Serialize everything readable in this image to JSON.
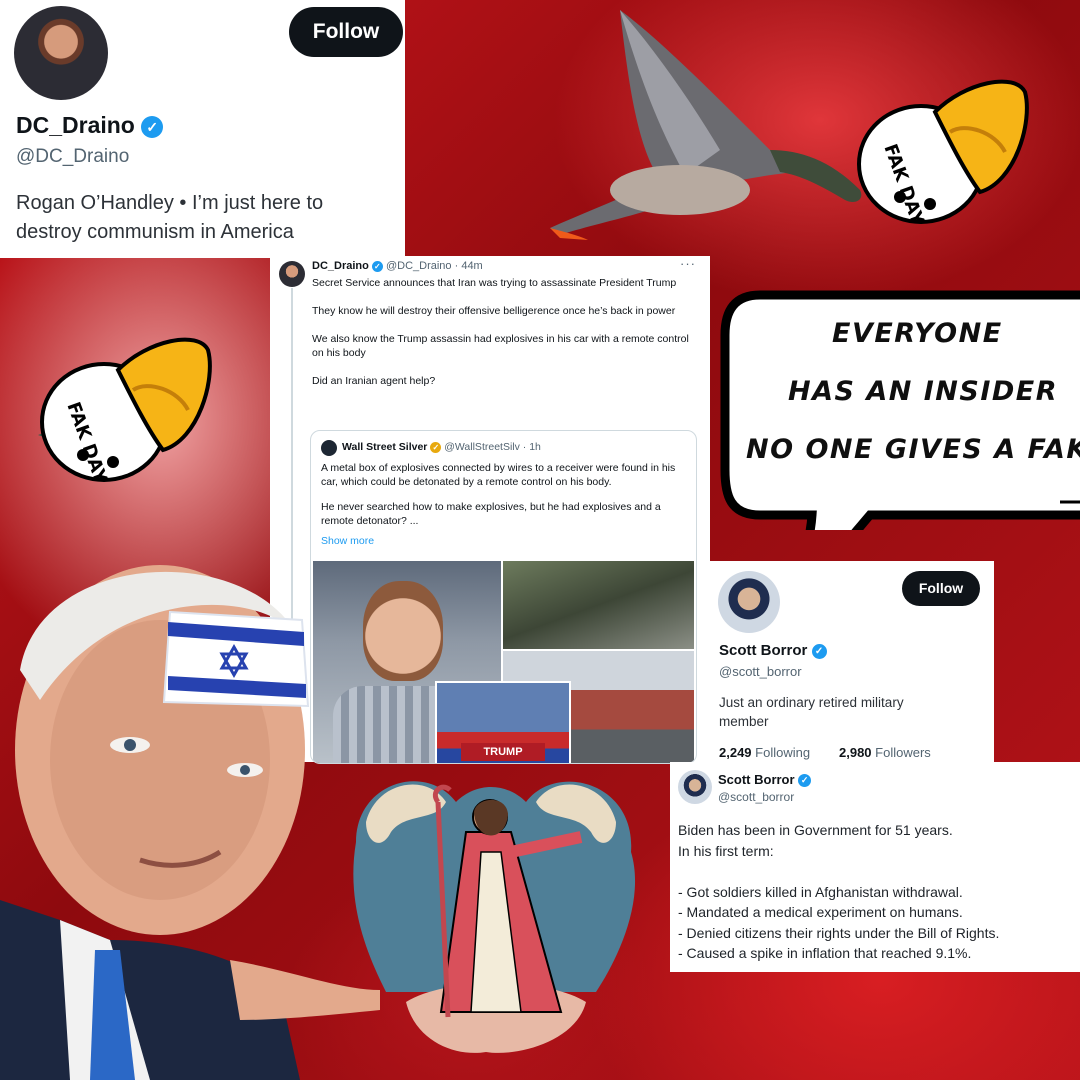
{
  "profile_card_1": {
    "name": "DC_Draino",
    "handle": "@DC_Draino",
    "bio": "Rogan O’Handley • I’m just here to destroy communism in America",
    "follow_label": "Follow"
  },
  "tweet_1": {
    "author": "DC_Draino",
    "handle_time": "@DC_Draino · 44m",
    "more": "···",
    "paragraphs": [
      "Secret Service announces that Iran was trying to assassinate President Trump",
      "They know he will destroy their offensive belligerence once he’s back in power",
      "We also know the Trump assassin had explosives in his car with a remote control on his body",
      "Did an Iranian agent help?"
    ],
    "quote": {
      "author": "Wall Street Silver",
      "handle_time": "@WallStreetSilv · 1h",
      "paragraphs": [
        "A metal box of explosives connected by wires to a receiver were found in his car, which could be detonated by a remote control on his body.",
        "He never searched how to make explosives, but he had explosives and a remote detonator? ..."
      ],
      "show_more": "Show more",
      "sign_text": "TRUMP"
    }
  },
  "speech_bubble": {
    "line1": "EVERYONE",
    "line2": "HAS AN INSIDER",
    "line3": "NO ONE GIVES A FAK"
  },
  "duck_badge": {
    "text": "FAK DAY"
  },
  "profile_card_2": {
    "name": "Scott Borror",
    "handle": "@scott_borror",
    "bio": "Just an ordinary retired military member",
    "follow_label": "Follow",
    "following_count": "2,249",
    "following_label": "Following",
    "followers_count": "2,980",
    "followers_label": "Followers"
  },
  "tweet_2": {
    "name": "Scott Borror",
    "handle": "@scott_borror",
    "line1": "Biden has been in Government for 51 years.",
    "line2": "In his first term:",
    "items": [
      "- Got soldiers killed in Afghanistan withdrawal.",
      "- Mandated a medical experiment on humans.",
      "- Denied citizens their rights under the Bill of Rights.",
      "- Caused a spike in inflation that reached 9.1%."
    ]
  },
  "colors": {
    "background": "#a30d12",
    "twitter_blue": "#1d9bf0",
    "follow_button": "#0f1419",
    "duck_yellow": "#f6b416"
  },
  "icons": [
    "verified-badge-icon",
    "more-options-icon",
    "star-of-david-icon",
    "duck-badge-icon"
  ]
}
